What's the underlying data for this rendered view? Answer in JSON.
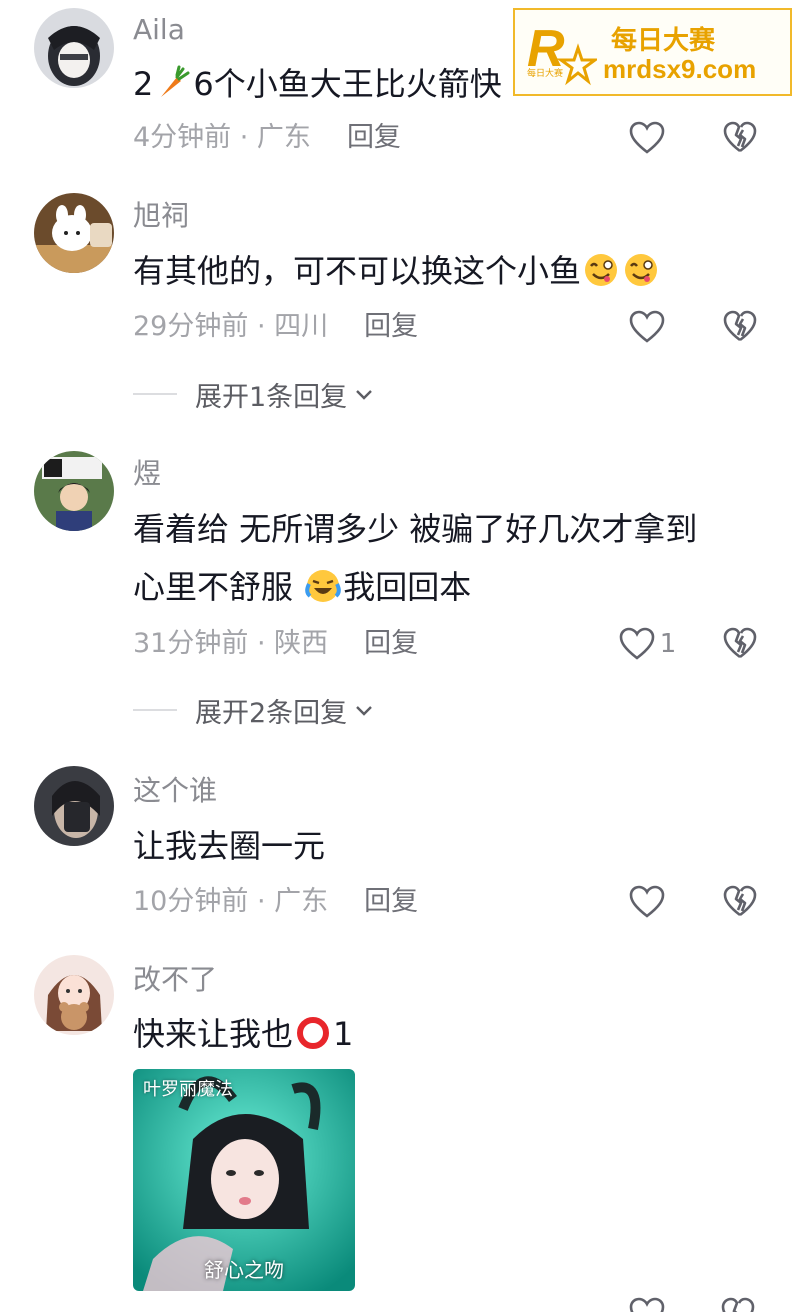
{
  "watermark": {
    "logo_letter": "R",
    "title": "每日大赛",
    "url": "mrdsx9.com",
    "small": "每日大赛",
    "color": "#e8a200"
  },
  "comments": [
    {
      "username": "Aila",
      "text_before": "2",
      "text_after": "6个小鱼大王比火箭快",
      "emoji": "carrot-emoji",
      "time": "4分钟前 · 广东",
      "reply": "回复",
      "likes": ""
    },
    {
      "username": "旭祠",
      "text_before": "有其他的，可不可以换这个小鱼",
      "emoji": "yummy-face-emoji",
      "time": "29分钟前 · 四川",
      "reply": "回复",
      "likes": "",
      "expand": "展开1条回复"
    },
    {
      "username": "煜",
      "line1": "看着给  无所谓多少  被骗了好几次才拿到",
      "line2_before": "心里不舒服 ",
      "line2_after": "我回回本",
      "emoji": "crying-laughing-emoji",
      "time": "31分钟前 · 陕西",
      "reply": "回复",
      "likes": "1",
      "expand": "展开2条回复"
    },
    {
      "username": "这个谁",
      "text": "让我去圈一元",
      "time": "10分钟前 · 广东",
      "reply": "回复",
      "likes": ""
    },
    {
      "username": "改不了",
      "text_before": "快来让我也",
      "text_after": "1",
      "emoji": "red-circle-emoji",
      "thumbnail": {
        "label": "叶罗丽魔法",
        "caption": "舒心之吻"
      }
    }
  ]
}
